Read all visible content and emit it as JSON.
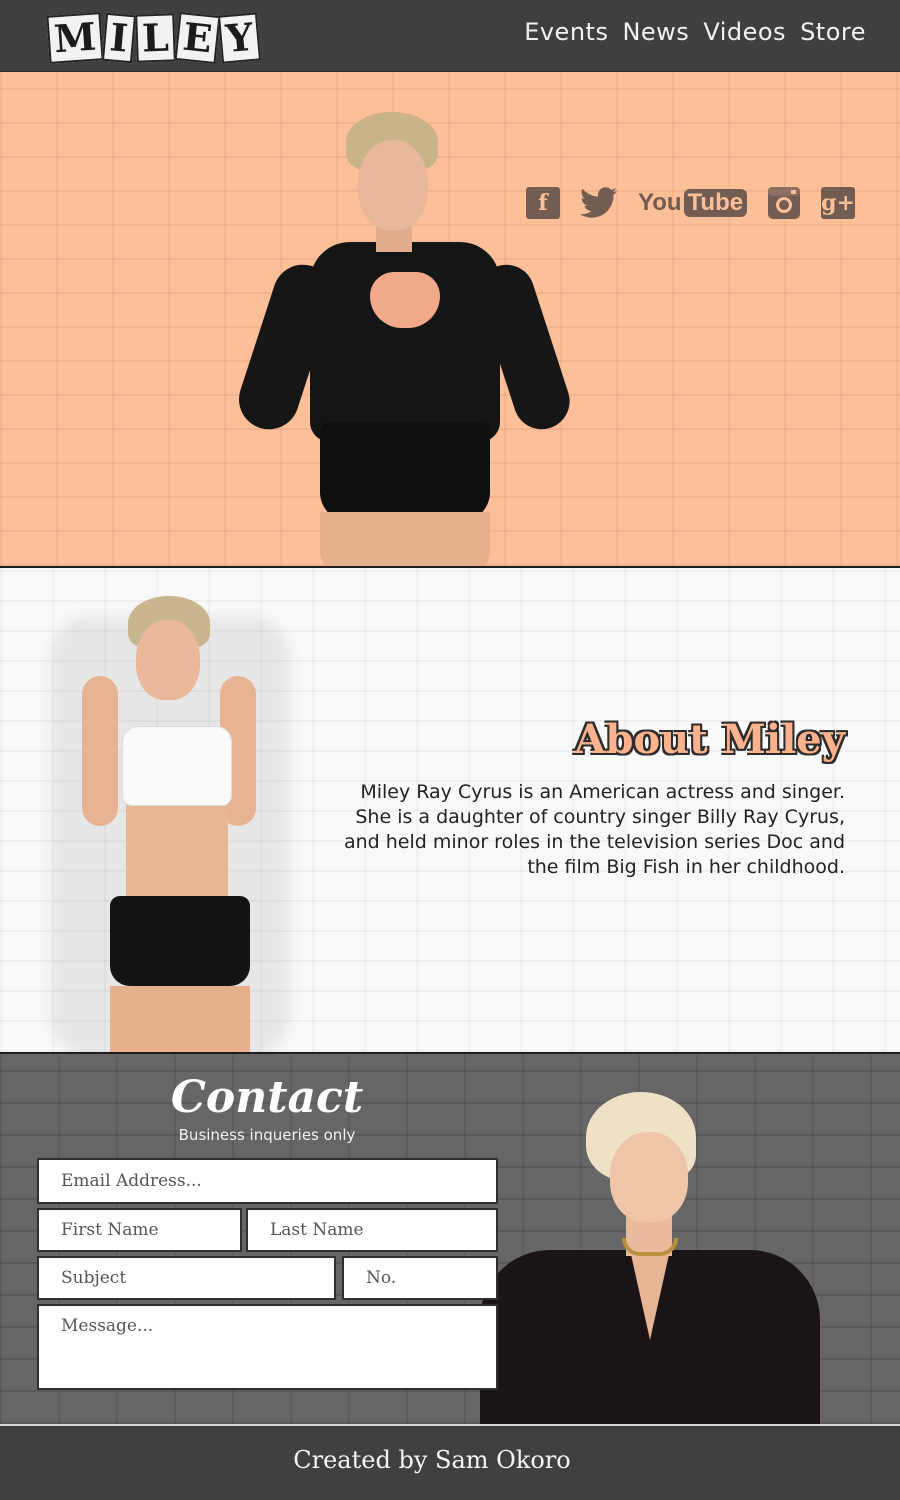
{
  "header": {
    "logo_letters": [
      "M",
      "I",
      "L",
      "E",
      "Y"
    ],
    "nav": [
      "Events",
      "News",
      "Videos",
      "Store"
    ]
  },
  "hero": {
    "social": {
      "facebook": "f",
      "youtube_you": "You",
      "youtube_tube": "Tube",
      "google_plus": "g+"
    }
  },
  "about": {
    "title": "About Miley",
    "text": "Miley Ray Cyrus is an American actress and singer. She is a daughter of country singer Billy Ray Cyrus, and held minor roles in the television series Doc and the film Big Fish in her childhood."
  },
  "contact": {
    "title": "Contact",
    "subtitle": "Business inqueries only",
    "placeholders": {
      "email": "Email Address...",
      "first": "First Name",
      "last": "Last Name",
      "subject": "Subject",
      "no": "No.",
      "message": "Message..."
    }
  },
  "footer": {
    "text": "Created by Sam Okoro"
  },
  "colors": {
    "hero_bg": "#fdbf98",
    "header_bg": "#3f3f3f",
    "about_title": "#fcb28c",
    "contact_bg": "#666666",
    "social_icon": "#735d52"
  },
  "icons": [
    "facebook-icon",
    "twitter-icon",
    "youtube-icon",
    "instagram-icon",
    "google-plus-icon"
  ]
}
